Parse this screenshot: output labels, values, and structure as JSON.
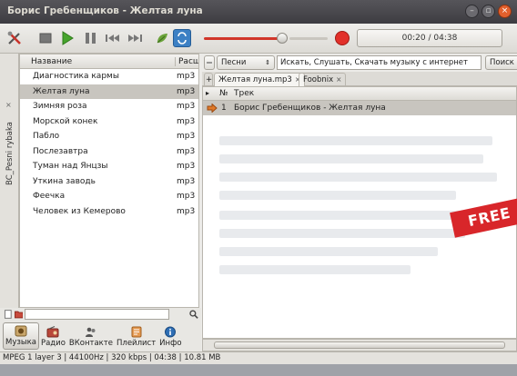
{
  "window": {
    "title": "Борис Гребенщиков - Желтая луна"
  },
  "toolbar": {
    "time": "00:20 / 04:38",
    "playback_progress": 0.072
  },
  "sidebar": {
    "tab_label": "BC_Pesni rybaka",
    "tab_close": "×",
    "columns": {
      "name": "Название",
      "ext": "Расш"
    },
    "items": [
      {
        "name": "Диагностика кармы",
        "ext": "mp3"
      },
      {
        "name": "Желтая луна",
        "ext": "mp3"
      },
      {
        "name": "Зимняя роза",
        "ext": "mp3"
      },
      {
        "name": "Морской конек",
        "ext": "mp3"
      },
      {
        "name": "Пабло",
        "ext": "mp3"
      },
      {
        "name": "Послезавтра",
        "ext": "mp3"
      },
      {
        "name": "Туман над Янцзы",
        "ext": "mp3"
      },
      {
        "name": "Уткина заводь",
        "ext": "mp3"
      },
      {
        "name": "Феечка",
        "ext": "mp3"
      },
      {
        "name": "Человек из Кемерово",
        "ext": "mp3"
      }
    ],
    "selected_index": 1
  },
  "nav": {
    "tabs": [
      {
        "label": "Музыка",
        "icon": "music-icon"
      },
      {
        "label": "Радио",
        "icon": "radio-icon"
      },
      {
        "label": "ВКонтакте",
        "icon": "vk-icon"
      },
      {
        "label": "Плейлист",
        "icon": "playlist-icon"
      },
      {
        "label": "Инфо",
        "icon": "info-icon"
      }
    ],
    "active": "Музыка"
  },
  "search": {
    "source": "Песни",
    "placeholder": "Искать, Слушать, Скачать музыку с интернет",
    "button": "Поиск"
  },
  "playlist_tabs": [
    {
      "label": "Желтая луна.mp3",
      "close": "×"
    },
    {
      "label": "Foobnix",
      "close": "×"
    }
  ],
  "tracklist": {
    "columns": {
      "num": "№",
      "track": "Трек"
    },
    "rows": [
      {
        "num": "1",
        "track": "Борис Гребенщиков - Желтая луна"
      }
    ]
  },
  "status": {
    "text": "MPEG 1 layer 3 | 44100Hz | 320 kbps | 04:38 | 10.81 MB"
  },
  "overlay": {
    "badge": "FREE"
  },
  "colors": {
    "accent_red": "#d1362a",
    "selection": "#c8c5bf",
    "title_bar": "#3d3c41"
  }
}
